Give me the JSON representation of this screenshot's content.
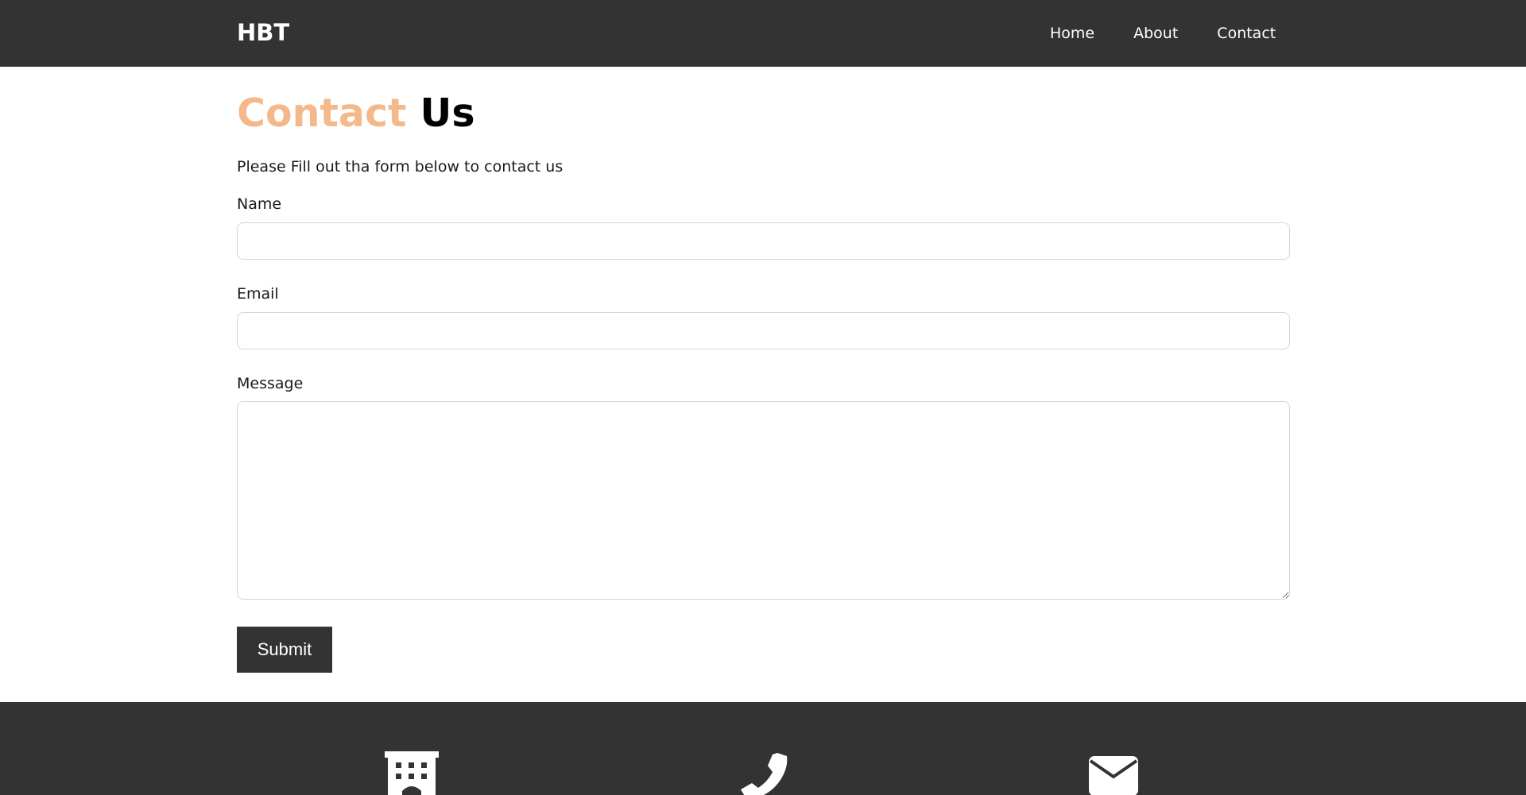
{
  "header": {
    "brand": "HBT",
    "nav": [
      {
        "label": "Home"
      },
      {
        "label": "About"
      },
      {
        "label": "Contact"
      }
    ]
  },
  "main": {
    "title_accent": "Contact",
    "title_rest": "Us",
    "intro": "Please Fill out tha form below to contact us",
    "form": {
      "name_label": "Name",
      "name_value": "",
      "email_label": "Email",
      "email_value": "",
      "message_label": "Message",
      "message_value": "",
      "submit_label": "Submit"
    }
  },
  "footer": {
    "icons": [
      "building-icon",
      "phone-icon",
      "envelope-icon"
    ]
  },
  "colors": {
    "header_bg": "#333333",
    "accent": "#f4b88a",
    "button_bg": "#333333",
    "footer_bg": "#333333"
  }
}
